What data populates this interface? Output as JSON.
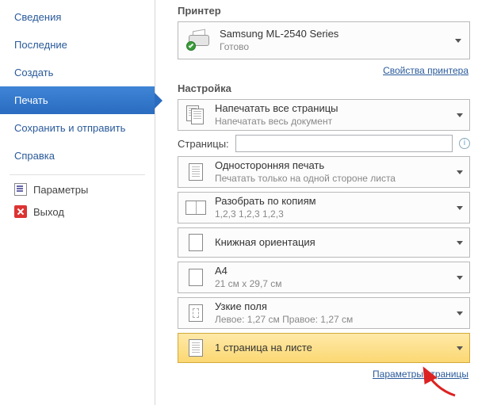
{
  "sidebar": {
    "items": [
      {
        "label": "Сведения"
      },
      {
        "label": "Последние"
      },
      {
        "label": "Создать"
      },
      {
        "label": "Печать"
      },
      {
        "label": "Сохранить и отправить"
      },
      {
        "label": "Справка"
      }
    ],
    "sub": {
      "params": "Параметры",
      "exit": "Выход"
    }
  },
  "printer_section": {
    "title": "Принтер",
    "name": "Samsung ML-2540 Series",
    "status": "Готово",
    "properties_link": "Свойства принтера"
  },
  "settings_section": {
    "title": "Настройка",
    "print_all": {
      "t1": "Напечатать все страницы",
      "t2": "Напечатать весь документ"
    },
    "pages_label": "Страницы:",
    "pages_value": "",
    "one_side": {
      "t1": "Односторонняя печать",
      "t2": "Печатать только на одной стороне листа"
    },
    "collate": {
      "t1": "Разобрать по копиям",
      "t2": "1,2,3   1,2,3   1,2,3"
    },
    "orientation": {
      "t1": "Книжная ориентация"
    },
    "paper": {
      "t1": "A4",
      "t2": "21 см x 29,7 см"
    },
    "margins": {
      "t1": "Узкие поля",
      "t2": "Левое: 1,27 см   Правое: 1,27 см"
    },
    "per_sheet": {
      "t1": "1 страница на листе"
    },
    "page_setup_link": "Параметры страницы"
  }
}
